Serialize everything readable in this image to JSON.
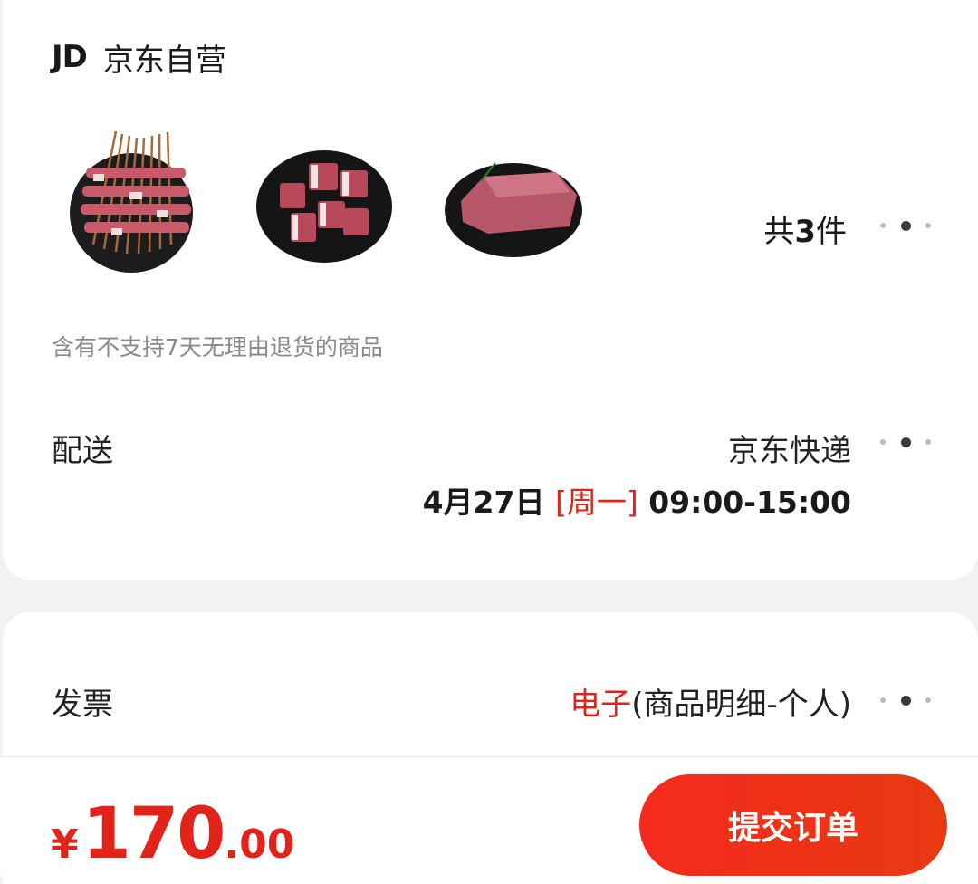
{
  "shop": {
    "logo": "JD",
    "name": "京东自营"
  },
  "products": [
    {
      "name": "skewers-plate"
    },
    {
      "name": "ribs-plate"
    },
    {
      "name": "beef-block-plate"
    }
  ],
  "summary": {
    "prefix": "共",
    "count": "3",
    "suffix": "件"
  },
  "notice": "含有不支持7天无理由退货的商品",
  "delivery": {
    "label": "配送",
    "method": "京东快递",
    "date": "4月27日",
    "weekday": "[周一]",
    "time": "09:00-15:00"
  },
  "invoice": {
    "label": "发票",
    "type": "电子",
    "detail": "(商品明细-个人)"
  },
  "footer": {
    "currency": "¥",
    "price_int": "170",
    "price_dec": ".00",
    "submit": "提交订单"
  },
  "colors": {
    "accent": "#e2231a",
    "button_start": "#f52a1e",
    "button_end": "#e73a12"
  },
  "icons": [
    "more-dots-icon"
  ]
}
